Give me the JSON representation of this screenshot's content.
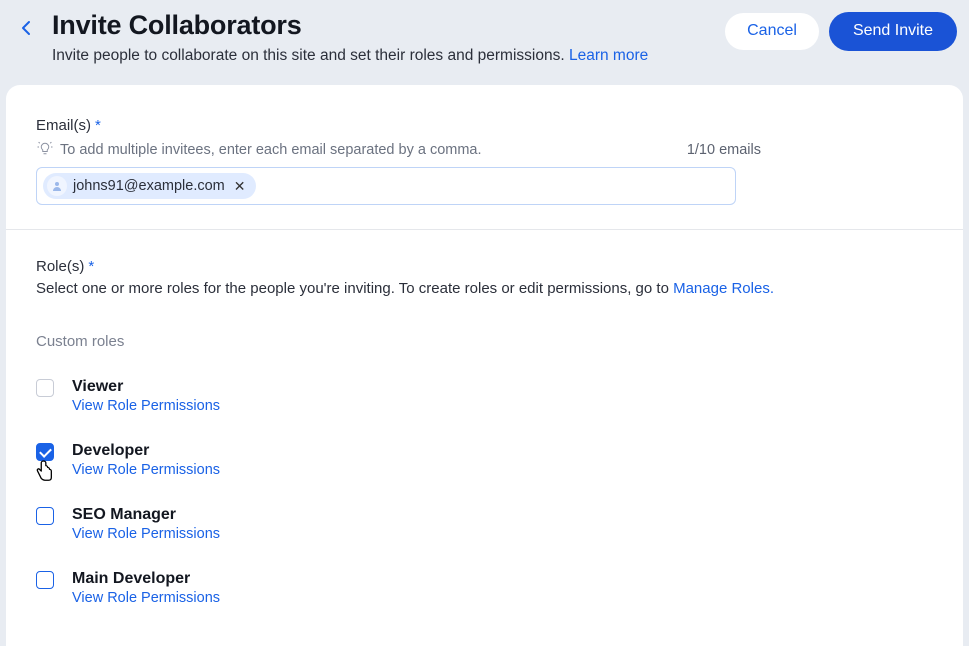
{
  "header": {
    "title": "Invite Collaborators",
    "subtitle_text": "Invite people to collaborate on this site and set their roles and permissions. ",
    "learn_more": "Learn more",
    "cancel": "Cancel",
    "send": "Send Invite"
  },
  "emails": {
    "label": "Email(s)",
    "hint": "To add multiple invitees, enter each email separated by a comma.",
    "counter": "1/10 emails",
    "chip": "johns91@example.com"
  },
  "roles": {
    "label": "Role(s)",
    "description": "Select one or more roles for the people you're inviting. To create roles or edit permissions, go to ",
    "manage_link": "Manage Roles.",
    "custom_label": "Custom roles",
    "view_link": "View Role Permissions",
    "items": [
      {
        "name": "Viewer",
        "checked": false,
        "greyBox": true
      },
      {
        "name": "Developer",
        "checked": true,
        "greyBox": false
      },
      {
        "name": "SEO Manager",
        "checked": false,
        "greyBox": false
      },
      {
        "name": "Main Developer",
        "checked": false,
        "greyBox": false
      }
    ]
  }
}
